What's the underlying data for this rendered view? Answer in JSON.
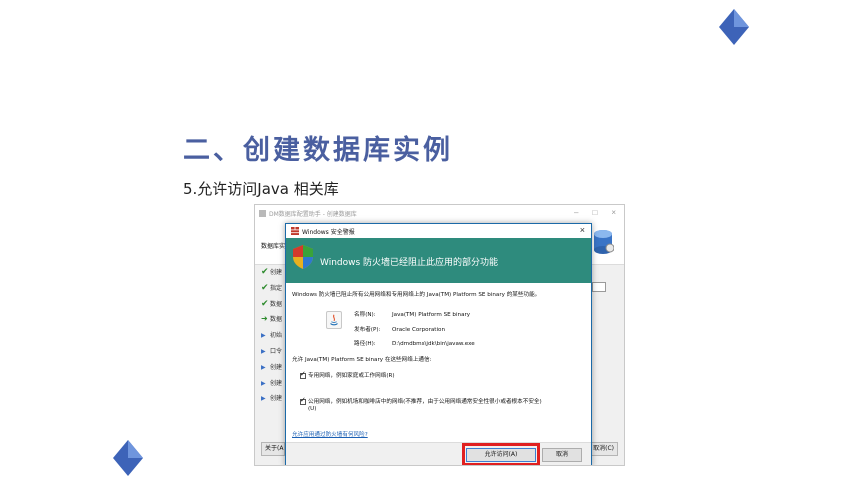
{
  "slide": {
    "title": "二、创建数据库实例",
    "subtitle": "5.允许访问Java 相关库"
  },
  "colors": {
    "title": "#4a5fa0",
    "diamond": "#4a74c9",
    "banner": "#2e8b7d",
    "highlight": "#e02020",
    "link": "#1a5fb4"
  },
  "back_window": {
    "title": "DM数据库配置助手 - 创建数据库",
    "controls": [
      "–",
      "□",
      "×"
    ],
    "heading": "数据库实",
    "steps": [
      {
        "marker": "check",
        "label": "创建"
      },
      {
        "marker": "check",
        "label": "指定"
      },
      {
        "marker": "check",
        "label": "数据"
      },
      {
        "marker": "arrow",
        "label": "数据"
      },
      {
        "marker": "tri",
        "label": "初始"
      },
      {
        "marker": "tri",
        "label": "口令"
      },
      {
        "marker": "tri",
        "label": "创建"
      },
      {
        "marker": "tri",
        "label": "创建"
      },
      {
        "marker": "tri",
        "label": "创建"
      }
    ],
    "about_button": "关于(A)",
    "cancel_button": "取消(C)"
  },
  "dialog": {
    "title": "Windows 安全警报",
    "close": "×",
    "banner": "Windows 防火墙已经阻止此应用的部分功能",
    "description": "Windows 防火墙已阻止所有公用网络和专用网络上的 Java(TM) Platform SE binary 的某些功能。",
    "info": [
      {
        "key": "名称(N):",
        "value": "Java(TM) Platform SE binary"
      },
      {
        "key": "发布者(P):",
        "value": "Oracle Corporation"
      },
      {
        "key": "路径(H):",
        "value": "D:\\dmdbms\\jdk\\bin\\javaw.exe"
      }
    ],
    "allow_prompt": "允许 Java(TM) Platform SE binary 在这些网络上通信:",
    "private_network": "专用网络，例如家庭或工作网络(R)",
    "public_network": "公用网络，例如机场和咖啡店中的网络(不推荐，由于公用网络通常安全性很小或者根本不安全)",
    "public_network_suffix": "(U)",
    "link": "允许应用通过防火墙有何风险?",
    "allow_button": "允许访问(A)",
    "cancel_button": "取消"
  }
}
